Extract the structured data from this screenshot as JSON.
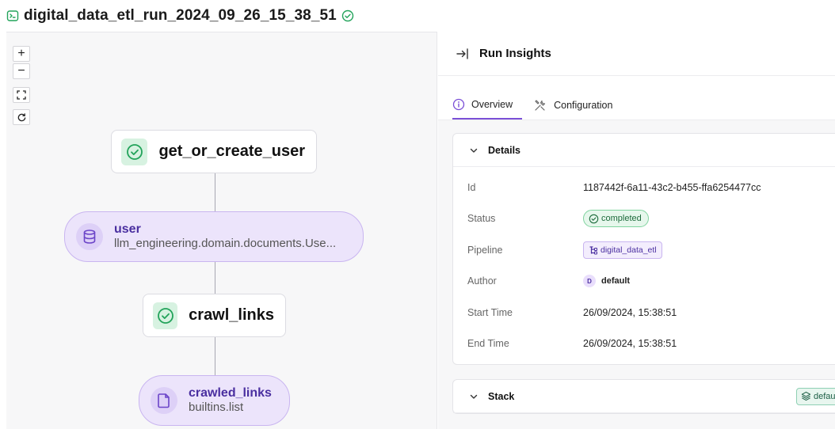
{
  "header": {
    "title": "digital_data_etl_run_2024_09_26_15_38_51"
  },
  "dag": {
    "controls": [
      "+",
      "−"
    ],
    "steps": [
      {
        "label": "get_or_create_user"
      },
      {
        "label": "crawl_links"
      }
    ],
    "artifacts": [
      {
        "name": "user",
        "type": "llm_engineering.domain.documents.Use..."
      },
      {
        "name": "crawled_links",
        "type": "builtins.list"
      }
    ]
  },
  "panel": {
    "title": "Run Insights",
    "tabs": [
      {
        "label": "Overview",
        "active": true
      },
      {
        "label": "Configuration",
        "active": false
      }
    ],
    "details": {
      "heading": "Details",
      "id_label": "Id",
      "id_value": "1187442f-6a11-43c2-b455-ffa6254477cc",
      "status_label": "Status",
      "status_value": "completed",
      "pipeline_label": "Pipeline",
      "pipeline_value": "digital_data_etl",
      "author_label": "Author",
      "author_initial": "D",
      "author_value": "default",
      "start_label": "Start Time",
      "start_value": "26/09/2024, 15:38:51",
      "end_label": "End Time",
      "end_value": "26/09/2024, 15:38:51"
    },
    "stack": {
      "heading": "Stack",
      "value": "default"
    }
  },
  "colors": {
    "accent": "#7a4fd6",
    "success": "#22a35a",
    "artifact_bg": "#ece4fb"
  }
}
